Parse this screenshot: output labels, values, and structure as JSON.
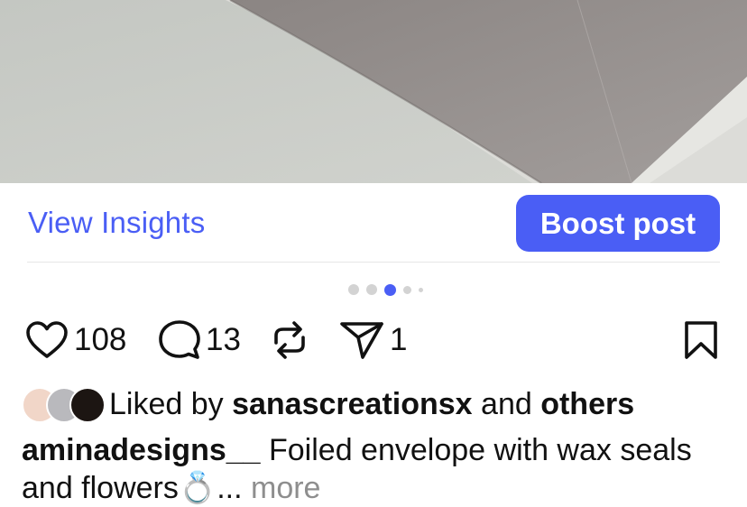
{
  "post": {
    "image_alt": "Foiled envelope photo",
    "view_insights_label": "View Insights",
    "boost_label": "Boost post",
    "carousel": {
      "count": 5,
      "active_index": 2
    },
    "actions": {
      "likes": "108",
      "comments": "13",
      "shares": "1"
    },
    "liked_by": {
      "prefix": "Liked by ",
      "user": "sanascreationsx",
      "middle": " and ",
      "others": "others"
    },
    "caption": {
      "username": "aminadesigns__",
      "text": " Foiled envelope with wax seals and flowers💍",
      "ellipsis": "... ",
      "more_label": "more"
    },
    "colors": {
      "accent": "#4a5ef5",
      "muted": "#8e8e8e"
    },
    "icons": [
      "heart-icon",
      "comment-icon",
      "repost-icon",
      "share-icon",
      "bookmark-icon"
    ]
  }
}
